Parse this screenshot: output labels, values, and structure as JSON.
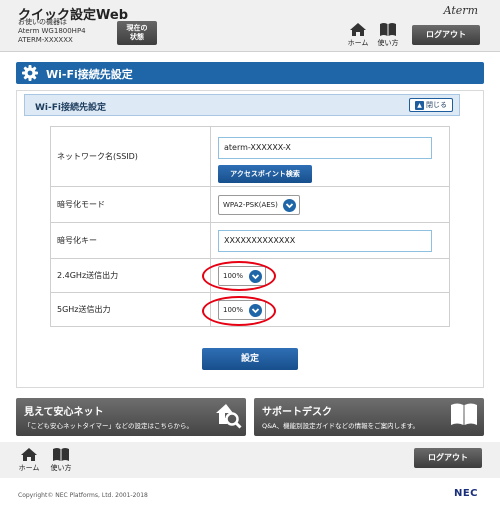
{
  "header": {
    "app_title": "クイック設定Web",
    "device_lines": [
      "お使いの機器は",
      "Aterm WG1800HP4",
      "ATERM-XXXXXX"
    ],
    "status_button_lines": [
      "現在の",
      "状態"
    ],
    "brand_logo": "Aterm",
    "home_label": "ホーム",
    "help_label": "使い方",
    "logout_label": "ログアウト"
  },
  "section": {
    "title": "Wi-Fi接続先設定",
    "icon": "gear-icon"
  },
  "panel": {
    "title": "Wi-Fi接続先設定",
    "close_label": "閉じる",
    "rows": [
      {
        "label": "ネットワーク名(SSID)",
        "value": "aterm-XXXXXX-X",
        "button": "アクセスポイント検索"
      },
      {
        "label": "暗号化モード",
        "value": "WPA2-PSK(AES)"
      },
      {
        "label": "暗号化キー",
        "value": "XXXXXXXXXXXXX"
      },
      {
        "label": "2.4GHz送信出力",
        "value": "100%"
      },
      {
        "label": "5GHz送信出力",
        "value": "100%"
      }
    ]
  },
  "apply_label": "設定",
  "banners": [
    {
      "title": "見えて安心ネット",
      "subtitle": "「こども安心ネットタイマー」などの設定はこちらから。",
      "icon": "house-magnifier-icon"
    },
    {
      "title": "サポートデスク",
      "subtitle": "Q&A、機能別設定ガイドなどの情報をご案内します。",
      "icon": "book-icon"
    }
  ],
  "footer": {
    "home_label": "ホーム",
    "help_label": "使い方",
    "logout_label": "ログアウト",
    "copyright": "Copyright© NEC Platforms, Ltd. 2001-2018",
    "nec_logo": "NEC"
  },
  "colors": {
    "primary": "#1f66a8",
    "dark_button": "#4a4a4a",
    "highlight_ring": "#e60012",
    "panel_head": "#dde9f4"
  }
}
